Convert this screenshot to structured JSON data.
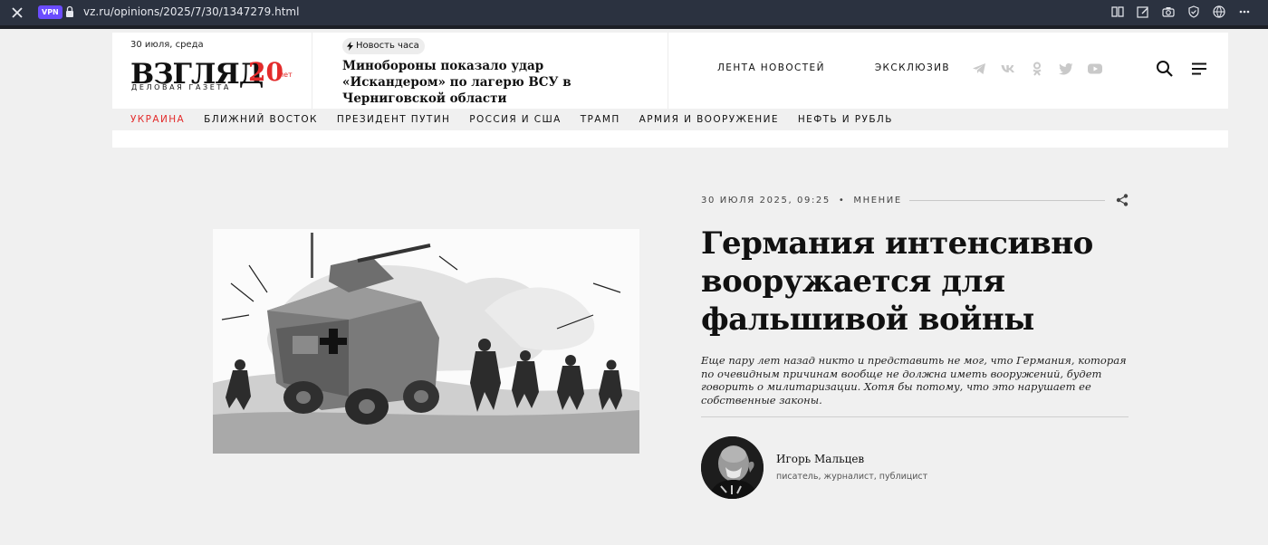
{
  "browser": {
    "vpn": "VPN",
    "url": "vz.ru/opinions/2025/7/30/1347279.html"
  },
  "header": {
    "date": "30 июля, среда",
    "logo": {
      "main": "ВЗГЛЯД",
      "sub": "ДЕЛОВАЯ ГАЗЕТА",
      "anniversary": "20",
      "anniversary_suffix": "лет"
    },
    "hot_badge": "Новость часа",
    "hot_title": "Минобороны показало удар «Искандером» по лагерю ВСУ в Черниговской области",
    "nav": [
      "ЛЕНТА НОВОСТЕЙ",
      "ЭКСКЛЮЗИВ"
    ],
    "social_icons": [
      "telegram-icon",
      "vk-icon",
      "odnoklassniki-icon",
      "twitter-icon",
      "youtube-icon"
    ]
  },
  "categories": [
    {
      "label": "УКРАИНА",
      "active": true
    },
    {
      "label": "БЛИЖНИЙ ВОСТОК",
      "active": false
    },
    {
      "label": "ПРЕЗИДЕНТ ПУТИН",
      "active": false
    },
    {
      "label": "РОССИЯ И США",
      "active": false
    },
    {
      "label": "ТРАМП",
      "active": false
    },
    {
      "label": "АРМИЯ И ВООРУЖЕНИЕ",
      "active": false
    },
    {
      "label": "НЕФТЬ И РУБЛЬ",
      "active": false
    }
  ],
  "article": {
    "datetime": "30 ИЮЛЯ 2025, 09:25",
    "section": "МНЕНИЕ",
    "title": "Германия интенсивно вооружается для фальшивой войны",
    "lede": "Еще пару лет назад никто и представить не мог, что Германия, которая по очевидным причинам вообще не должна иметь вооружений, будет говорить о милитаризации. Хотя бы потому, что это нарушает ее собственные законы.",
    "author": {
      "name": "Игорь Мальцев",
      "role": "писатель, журналист, публицист"
    }
  },
  "colors": {
    "accent": "#e32b2b",
    "browser_bar": "#2b3240",
    "vpn": "#6b4cff"
  }
}
